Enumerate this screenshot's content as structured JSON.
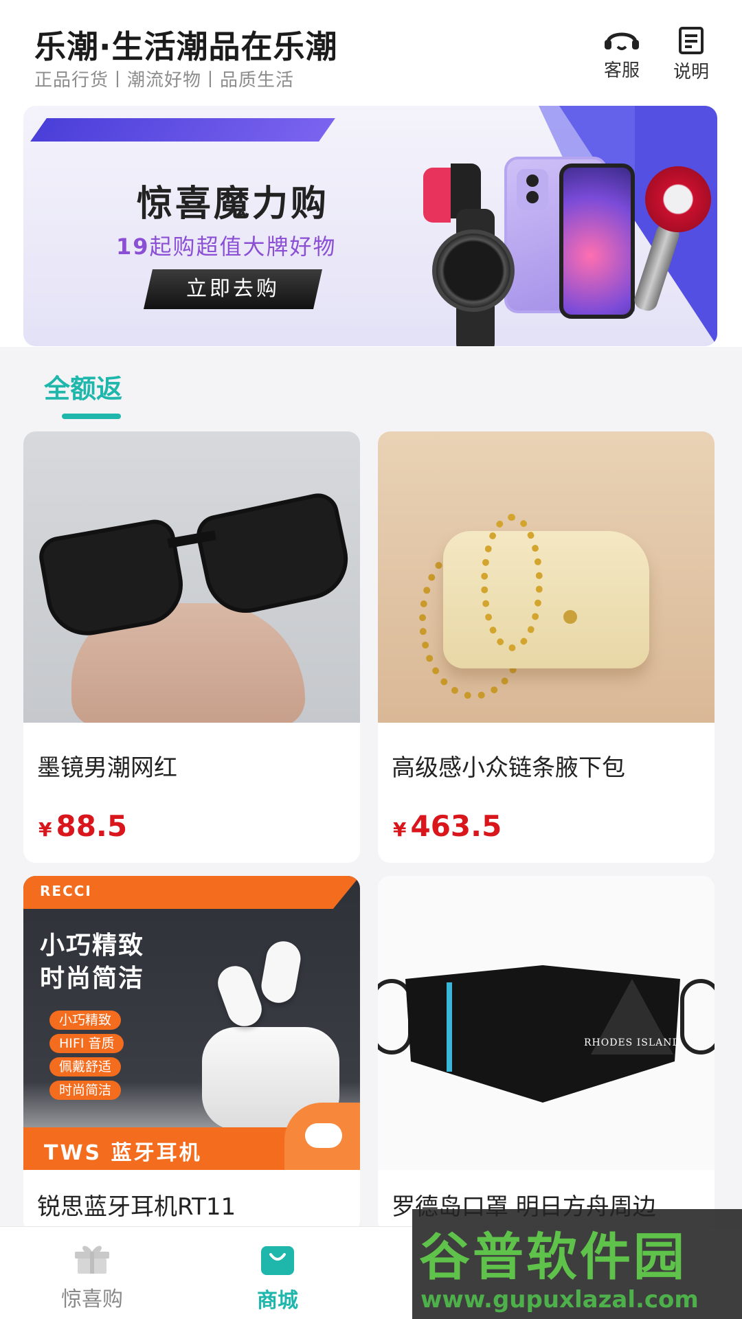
{
  "header": {
    "title": "乐潮·生活潮品在乐潮",
    "tagline": "正品行货丨潮流好物丨品质生活",
    "service_label": "客服",
    "explain_label": "说明"
  },
  "banner": {
    "title": "惊喜魔力购",
    "subtitle_num": "19",
    "subtitle_text": "起购超值大牌好物",
    "button_label": "立即去购"
  },
  "section": {
    "tab_label": "全额返"
  },
  "products": [
    {
      "name": "墨镜男潮网红",
      "currency": "¥",
      "price": "88.5"
    },
    {
      "name": "高级感小众链条腋下包",
      "currency": "¥",
      "price": "463.5"
    },
    {
      "name": "锐思蓝牙耳机RT11",
      "ad": {
        "brand": "RECCI",
        "headline1": "小巧精致",
        "headline2": "时尚简洁",
        "tags": [
          "小巧精致",
          "HIFI 音质",
          "佩戴舒适",
          "时尚简洁"
        ],
        "footer": "TWS 蓝牙耳机"
      }
    },
    {
      "name": "罗德岛口罩 明日方舟周边",
      "mask_text": "RHODES ISLAND"
    }
  ],
  "tabbar": {
    "items": [
      {
        "label": "惊喜购",
        "icon": "gift-icon",
        "active": false
      },
      {
        "label": "商城",
        "icon": "shopping-bag-icon",
        "active": true
      }
    ]
  },
  "watermark": {
    "text": "谷普软件园",
    "url": "www.gupuxlazal.com"
  },
  "colors": {
    "accent": "#1fb7ac",
    "price": "#d8161c",
    "banner_sub": "#8b4fd6",
    "orange": "#f46c1e"
  }
}
